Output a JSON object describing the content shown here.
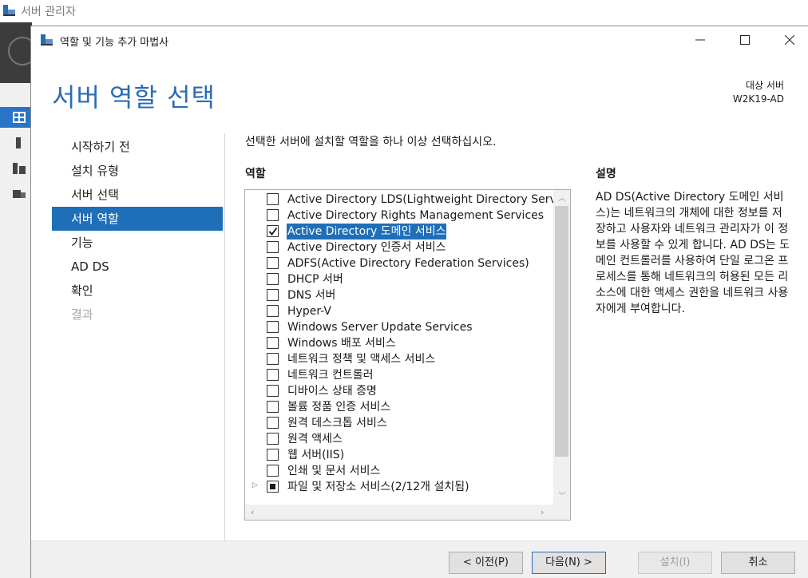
{
  "background_app": {
    "title": "서버 관리자"
  },
  "wizard": {
    "title": "역할 및 기능 추가 마법사",
    "page_title": "서버 역할 선택",
    "target_label": "대상 서버",
    "target_server": "W2K19-AD",
    "instruction": "선택한 서버에 설치할 역할을 하나 이상 선택하십시오.",
    "roles_header": "역할",
    "description_header": "설명",
    "description": "AD DS(Active Directory 도메인 서비스)는 네트워크의 개체에 대한 정보를 저장하고 사용자와 네트워크 관리자가 이 정보를 사용할 수 있게 합니다. AD DS는 도메인 컨트롤러를 사용하여 단일 로그온 프로세스를 통해 네트워크의 허용된 모든 리소스에 대한 액세스 권한을 네트워크 사용자에게 부여합니다."
  },
  "steps": [
    {
      "label": "시작하기 전",
      "state": "normal"
    },
    {
      "label": "설치 유형",
      "state": "normal"
    },
    {
      "label": "서버 선택",
      "state": "normal"
    },
    {
      "label": "서버 역할",
      "state": "active"
    },
    {
      "label": "기능",
      "state": "normal"
    },
    {
      "label": "AD DS",
      "state": "normal"
    },
    {
      "label": "확인",
      "state": "normal"
    },
    {
      "label": "결과",
      "state": "disabled"
    }
  ],
  "roles": [
    {
      "label": "Active Directory LDS(Lightweight Directory Services)",
      "checked": false,
      "selected": false,
      "expandable": false
    },
    {
      "label": "Active Directory Rights Management Services",
      "checked": false,
      "selected": false,
      "expandable": false
    },
    {
      "label": "Active Directory 도메인 서비스",
      "checked": true,
      "selected": true,
      "expandable": false
    },
    {
      "label": "Active Directory 인증서 서비스",
      "checked": false,
      "selected": false,
      "expandable": false
    },
    {
      "label": "ADFS(Active Directory Federation Services)",
      "checked": false,
      "selected": false,
      "expandable": false
    },
    {
      "label": "DHCP 서버",
      "checked": false,
      "selected": false,
      "expandable": false
    },
    {
      "label": "DNS 서버",
      "checked": false,
      "selected": false,
      "expandable": false
    },
    {
      "label": "Hyper-V",
      "checked": false,
      "selected": false,
      "expandable": false
    },
    {
      "label": "Windows Server Update Services",
      "checked": false,
      "selected": false,
      "expandable": false
    },
    {
      "label": "Windows 배포 서비스",
      "checked": false,
      "selected": false,
      "expandable": false
    },
    {
      "label": "네트워크 정책 및 액세스 서비스",
      "checked": false,
      "selected": false,
      "expandable": false
    },
    {
      "label": "네트워크 컨트롤러",
      "checked": false,
      "selected": false,
      "expandable": false
    },
    {
      "label": "디바이스 상태 증명",
      "checked": false,
      "selected": false,
      "expandable": false
    },
    {
      "label": "볼륨 정품 인증 서비스",
      "checked": false,
      "selected": false,
      "expandable": false
    },
    {
      "label": "원격 데스크톱 서비스",
      "checked": false,
      "selected": false,
      "expandable": false
    },
    {
      "label": "원격 액세스",
      "checked": false,
      "selected": false,
      "expandable": false
    },
    {
      "label": "웹 서버(IIS)",
      "checked": false,
      "selected": false,
      "expandable": false
    },
    {
      "label": "인쇄 및 문서 서비스",
      "checked": false,
      "selected": false,
      "expandable": false
    },
    {
      "label": "파일 및 저장소 서비스(2/12개 설치됨)",
      "checked": "partial",
      "selected": false,
      "expandable": true
    }
  ],
  "buttons": {
    "previous": "< 이전(P)",
    "next": "다음(N) >",
    "install": "설치(I)",
    "cancel": "취소"
  },
  "colors": {
    "accent": "#1f6fb8",
    "page_title": "#2a6cb4",
    "disabled_text": "#a8a8a8"
  },
  "icons": {
    "app": "server-manager-icon",
    "wizard": "server-manager-icon",
    "nav": [
      "dashboard-icon",
      "local-server-icon",
      "all-servers-icon",
      "file-storage-icon"
    ]
  }
}
